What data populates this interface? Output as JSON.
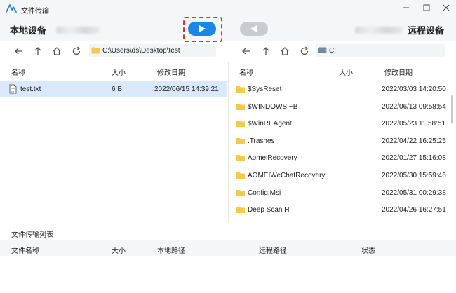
{
  "window": {
    "title": "文件传输"
  },
  "devices": {
    "local_label": "本地设备",
    "remote_label": "远程设备"
  },
  "left_panel": {
    "path": "C:\\Users\\ds\\Desktop\\test",
    "columns": {
      "name": "名称",
      "size": "大小",
      "modified": "修改日期"
    },
    "files": [
      {
        "name": "test.txt",
        "size": "6 B",
        "modified": "2022/06/15 14:39:21",
        "icon": "text-file-icon",
        "selected": true
      }
    ]
  },
  "right_panel": {
    "path": "C:",
    "columns": {
      "name": "名称",
      "size": "大小",
      "modified": "修改日期"
    },
    "files": [
      {
        "name": "$SysReset",
        "modified": "2022/03/03 14:20:50",
        "icon": "folder-icon"
      },
      {
        "name": "$WINDOWS.~BT",
        "modified": "2022/06/13 09:58:54",
        "icon": "folder-icon"
      },
      {
        "name": "$WinREAgent",
        "modified": "2022/05/23 11:58:51",
        "icon": "folder-icon"
      },
      {
        "name": ".Trashes",
        "modified": "2022/04/22 16:25:25",
        "icon": "folder-icon"
      },
      {
        "name": "AomeiRecovery",
        "modified": "2022/01/27 15:16:08",
        "icon": "folder-icon"
      },
      {
        "name": "AOMEIWeChatRecovery",
        "modified": "2022/05/30 15:59:46",
        "icon": "folder-icon"
      },
      {
        "name": "Config.Msi",
        "modified": "2022/05/31 00:29:38",
        "icon": "folder-icon"
      },
      {
        "name": "Deep Scan H",
        "modified": "2022/04/26 16:27:51",
        "icon": "folder-icon"
      }
    ]
  },
  "transfer_list": {
    "title": "文件传输列表",
    "columns": {
      "file_name": "文件名称",
      "size": "大小",
      "local_path": "本地路径",
      "remote_path": "远程路径",
      "status": "状态"
    }
  },
  "colors": {
    "accent": "#1a86e8",
    "selected_row": "#d9e8fb",
    "highlight_border": "#d83232",
    "folder": "#f6c94a"
  }
}
